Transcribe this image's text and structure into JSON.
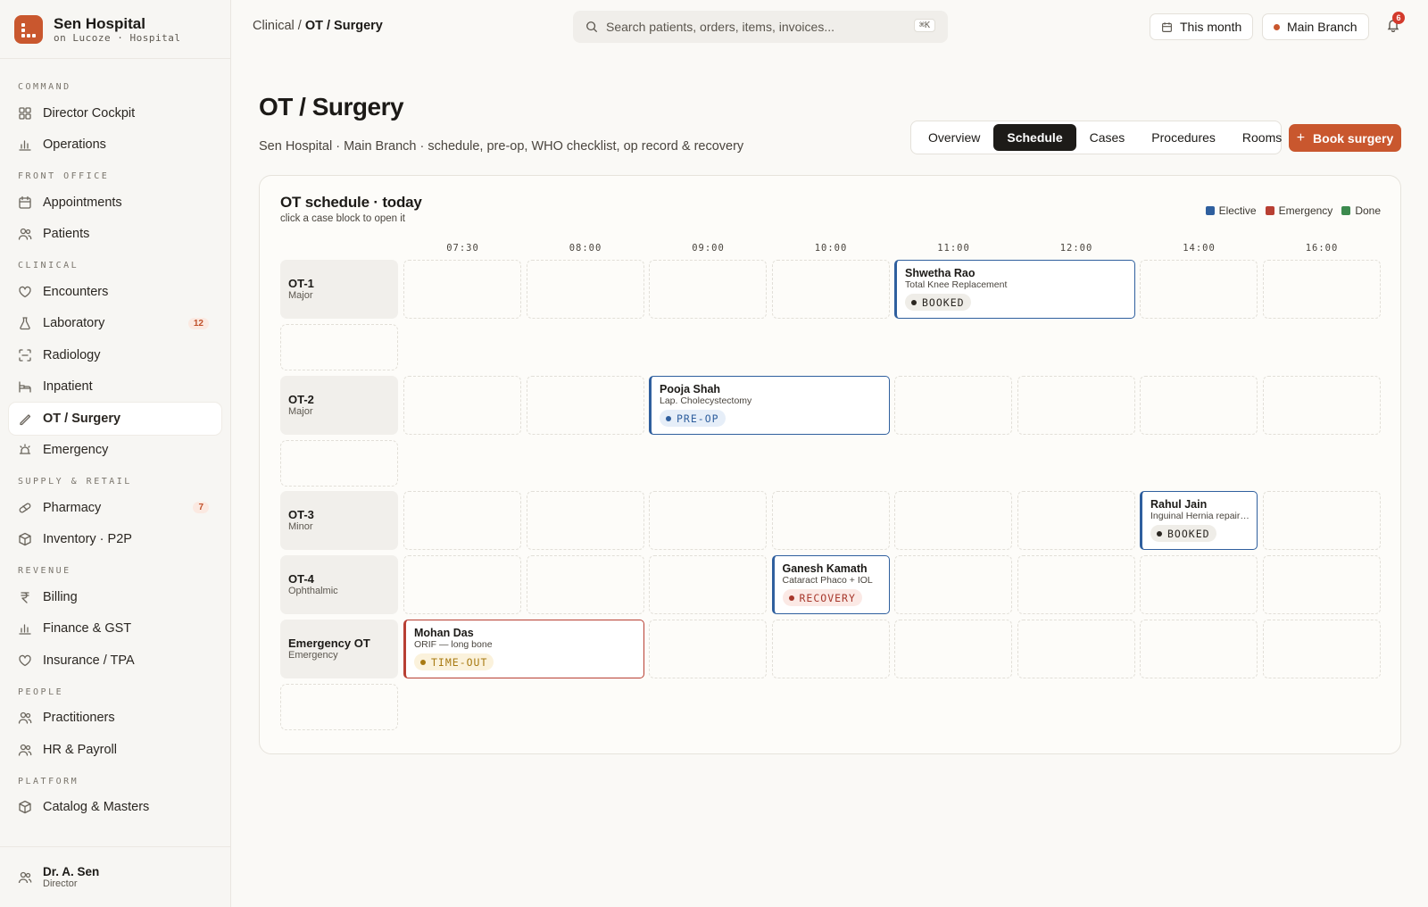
{
  "brand": {
    "name": "Sen Hospital",
    "subtitle": "on Lucoze · Hospital"
  },
  "sidebar": {
    "groups": [
      {
        "label": "COMMAND",
        "items": [
          {
            "label": "Director Cockpit",
            "icon": "grid-icon"
          },
          {
            "label": "Operations",
            "icon": "bar-chart-icon"
          }
        ]
      },
      {
        "label": "FRONT OFFICE",
        "items": [
          {
            "label": "Appointments",
            "icon": "calendar-icon"
          },
          {
            "label": "Patients",
            "icon": "users-icon"
          }
        ]
      },
      {
        "label": "CLINICAL",
        "items": [
          {
            "label": "Encounters",
            "icon": "heart-icon"
          },
          {
            "label": "Laboratory",
            "icon": "flask-icon",
            "badge": "12"
          },
          {
            "label": "Radiology",
            "icon": "scan-icon"
          },
          {
            "label": "Inpatient",
            "icon": "bed-icon"
          },
          {
            "label": "OT / Surgery",
            "icon": "scalpel-icon",
            "active": true
          },
          {
            "label": "Emergency",
            "icon": "siren-icon"
          }
        ]
      },
      {
        "label": "SUPPLY & RETAIL",
        "items": [
          {
            "label": "Pharmacy",
            "icon": "pill-icon",
            "badge": "7"
          },
          {
            "label": "Inventory · P2P",
            "icon": "box-icon"
          }
        ]
      },
      {
        "label": "REVENUE",
        "items": [
          {
            "label": "Billing",
            "icon": "rupee-icon"
          },
          {
            "label": "Finance & GST",
            "icon": "bar-chart-icon"
          },
          {
            "label": "Insurance / TPA",
            "icon": "heart-icon"
          }
        ]
      },
      {
        "label": "PEOPLE",
        "items": [
          {
            "label": "Practitioners",
            "icon": "users-icon"
          },
          {
            "label": "HR & Payroll",
            "icon": "users-icon"
          }
        ]
      },
      {
        "label": "PLATFORM",
        "items": [
          {
            "label": "Catalog & Masters",
            "icon": "box-icon"
          }
        ]
      }
    ],
    "user": {
      "name": "Dr. A. Sen",
      "role": "Director"
    }
  },
  "topbar": {
    "breadcrumb_parent": "Clinical / ",
    "breadcrumb_current": "OT / Surgery",
    "search_placeholder": "Search patients, orders, items, invoices...",
    "search_shortcut": "⌘K",
    "period_label": "This month",
    "branch_label": "Main Branch",
    "notification_count": "6"
  },
  "header": {
    "title": "OT / Surgery",
    "subtitle": "Sen Hospital · Main Branch · schedule, pre-op, WHO checklist, op record & recovery",
    "tabs": [
      "Overview",
      "Schedule",
      "Cases",
      "Procedures",
      "Rooms"
    ],
    "active_tab": "Schedule",
    "book_button": "Book surgery"
  },
  "schedule": {
    "title": "OT schedule · today",
    "subtitle": "click a case block to open it",
    "legend": [
      {
        "label": "Elective",
        "color": "#2f5f9e"
      },
      {
        "label": "Emergency",
        "color": "#b83f33"
      },
      {
        "label": "Done",
        "color": "#3c8a4e"
      }
    ],
    "hours": [
      "07:30",
      "08:00",
      "09:00",
      "10:00",
      "11:00",
      "12:00",
      "14:00",
      "16:00"
    ],
    "rooms": [
      {
        "name": "OT-1",
        "type": "Major"
      },
      {
        "name": "OT-2",
        "type": "Major"
      },
      {
        "name": "OT-3",
        "type": "Minor"
      },
      {
        "name": "OT-4",
        "type": "Ophthalmic"
      },
      {
        "name": "Emergency OT",
        "type": "Emergency"
      }
    ],
    "cases": [
      {
        "patient": "Shwetha Rao",
        "procedure": "Total Knee Replacement",
        "status": "BOOKED",
        "kind": "elective",
        "room": "OT-1",
        "start_slot": "11:00",
        "end_slot": "12:00"
      },
      {
        "patient": "Pooja Shah",
        "procedure": "Lap. Cholecystectomy",
        "status": "PRE-OP",
        "kind": "elective",
        "room": "OT-2",
        "start_slot": "09:00",
        "end_slot": "10:00"
      },
      {
        "patient": "Rahul Jain",
        "procedure": "Inguinal Hernia repair ...",
        "status": "BOOKED",
        "kind": "elective",
        "room": "OT-3",
        "start_slot": "14:00",
        "end_slot": "14:00"
      },
      {
        "patient": "Ganesh Kamath",
        "procedure": "Cataract Phaco + IOL",
        "status": "RECOVERY",
        "kind": "elective",
        "room": "OT-4",
        "start_slot": "10:00",
        "end_slot": "10:00"
      },
      {
        "patient": "Mohan Das",
        "procedure": "ORIF — long bone",
        "status": "TIME-OUT",
        "kind": "emergency",
        "room": "Emergency OT",
        "start_slot": "07:30",
        "end_slot": "08:00"
      }
    ]
  }
}
